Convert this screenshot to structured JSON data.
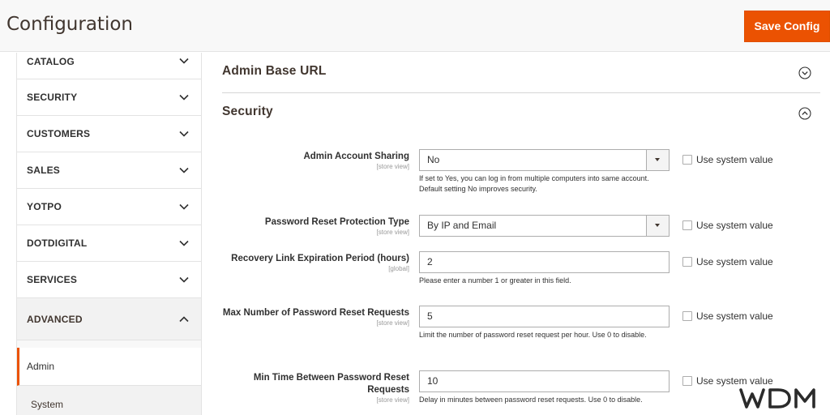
{
  "header": {
    "title": "Configuration",
    "save_label": "Save Config",
    "accent_color": "#eb5202"
  },
  "sidebar": {
    "items": [
      {
        "label": "CATALOG",
        "icon": "chevron-down-icon"
      },
      {
        "label": "SECURITY",
        "icon": "chevron-down-icon"
      },
      {
        "label": "CUSTOMERS",
        "icon": "chevron-down-icon"
      },
      {
        "label": "SALES",
        "icon": "chevron-down-icon"
      },
      {
        "label": "YOTPO",
        "icon": "chevron-down-icon"
      },
      {
        "label": "DOTDIGITAL",
        "icon": "chevron-down-icon"
      },
      {
        "label": "SERVICES",
        "icon": "chevron-down-icon"
      },
      {
        "label": "ADVANCED",
        "icon": "chevron-up-icon",
        "expanded": true
      }
    ],
    "sub_items": [
      {
        "label": "Admin",
        "active": true
      },
      {
        "label": "System",
        "active": false
      }
    ]
  },
  "main": {
    "sections": [
      {
        "title": "Admin Base URL",
        "icon": "chevron-circle-down-icon"
      },
      {
        "title": "Security",
        "icon": "chevron-circle-up-icon"
      }
    ],
    "fields": [
      {
        "label": "Admin Account Sharing",
        "scope": "[store view]",
        "type": "select",
        "value": "No",
        "note": "If set to Yes, you can log in from multiple computers into same account. Default setting No improves security.",
        "system_value_label": "Use system value"
      },
      {
        "label": "Password Reset Protection Type",
        "scope": "[store view]",
        "type": "select",
        "value": "By IP and Email",
        "note": "",
        "system_value_label": "Use system value"
      },
      {
        "label": "Recovery Link Expiration Period (hours)",
        "scope": "[global]",
        "type": "text",
        "value": "2",
        "note": "Please enter a number 1 or greater in this field.",
        "system_value_label": "Use system value"
      },
      {
        "label": "Max Number of Password Reset Requests",
        "scope": "[store view]",
        "type": "text",
        "value": "5",
        "note": "Limit the number of password reset request per hour. Use 0 to disable.",
        "system_value_label": "Use system value"
      },
      {
        "label": "Min Time Between Password Reset Requests",
        "scope": "[store view]",
        "type": "text",
        "value": "10",
        "note": "Delay in minutes between password reset requests. Use 0 to disable.",
        "system_value_label": "Use system value"
      }
    ]
  },
  "watermark": {
    "text": "WDM"
  }
}
